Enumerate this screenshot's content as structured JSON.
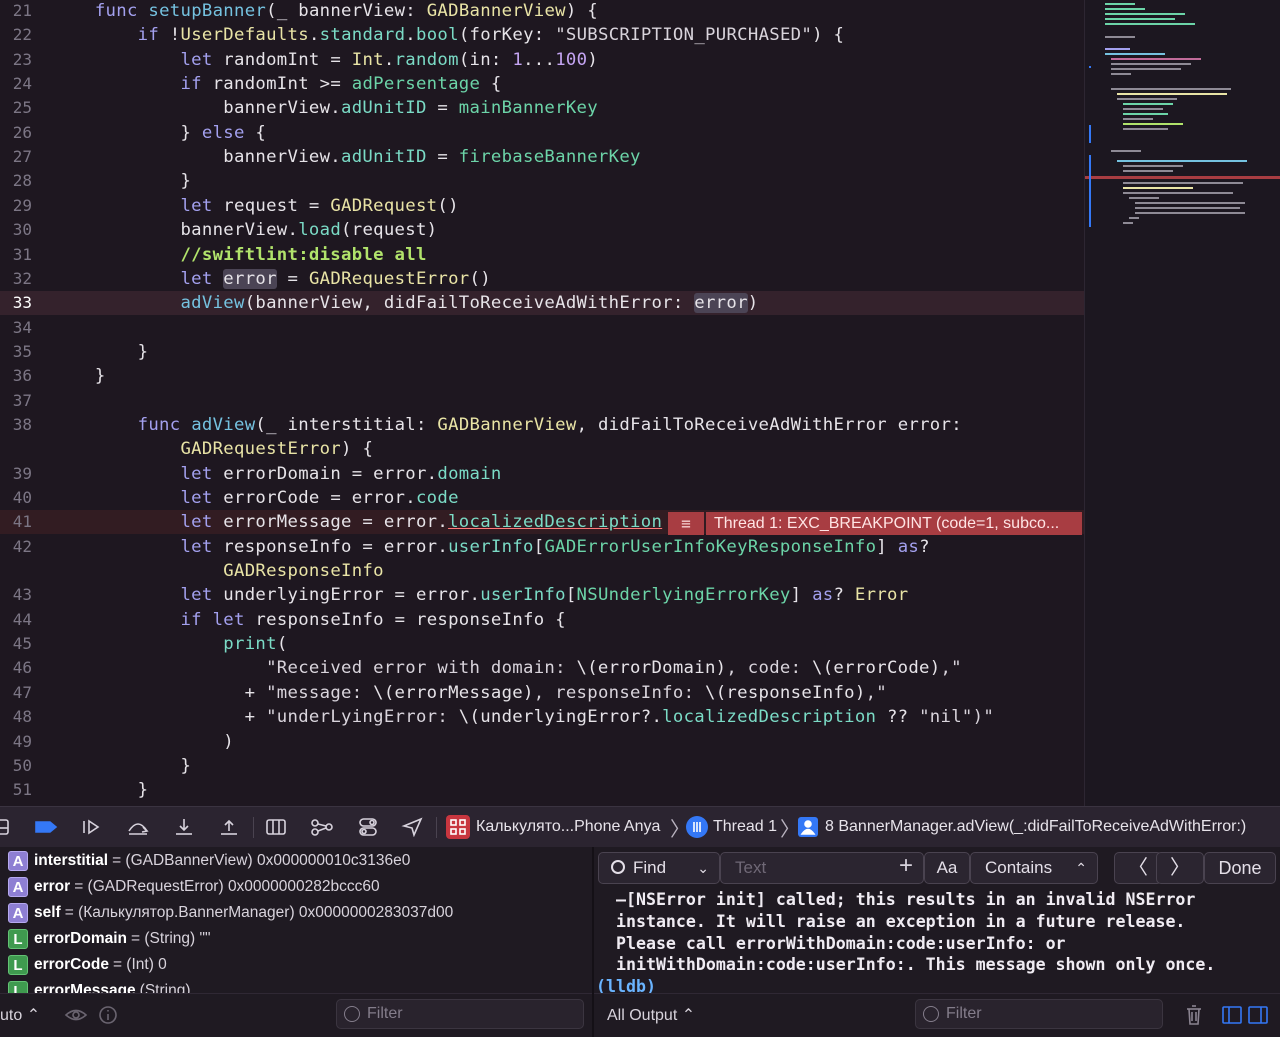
{
  "editor": {
    "lines": [
      {
        "n": "21",
        "tokens": [
          [
            "    ",
            ""
          ],
          [
            "func",
            "kw"
          ],
          [
            " ",
            ""
          ],
          [
            "setupBanner",
            "fn"
          ],
          [
            "(_ bannerView: ",
            ""
          ],
          [
            "GADBannerView",
            "ty"
          ],
          [
            ") {",
            ""
          ]
        ]
      },
      {
        "n": "22",
        "tokens": [
          [
            "        ",
            ""
          ],
          [
            "if",
            "kw"
          ],
          [
            " !",
            ""
          ],
          [
            "UserDefaults",
            "ty"
          ],
          [
            ".",
            ""
          ],
          [
            "standard",
            "pr"
          ],
          [
            ".",
            ""
          ],
          [
            "bool",
            "pr"
          ],
          [
            "(forKey: ",
            ""
          ],
          [
            "\"SUBSCRIPTION_PURCHASED\"",
            "st"
          ],
          [
            ") {",
            ""
          ]
        ]
      },
      {
        "n": "23",
        "tokens": [
          [
            "            ",
            ""
          ],
          [
            "let",
            "kw"
          ],
          [
            " randomInt = ",
            ""
          ],
          [
            "Int",
            "ty"
          ],
          [
            ".",
            ""
          ],
          [
            "random",
            "pr"
          ],
          [
            "(in: ",
            ""
          ],
          [
            "1",
            "nm"
          ],
          [
            "...",
            ""
          ],
          [
            "100",
            "nm"
          ],
          [
            ")",
            ""
          ]
        ]
      },
      {
        "n": "24",
        "tokens": [
          [
            "            ",
            ""
          ],
          [
            "if",
            "kw"
          ],
          [
            " randomInt >= ",
            ""
          ],
          [
            "adPersentage",
            "vr"
          ],
          [
            " {",
            ""
          ]
        ]
      },
      {
        "n": "25",
        "tokens": [
          [
            "                bannerView.",
            ""
          ],
          [
            "adUnitID",
            "pr"
          ],
          [
            " = ",
            ""
          ],
          [
            "mainBannerKey",
            "vr"
          ]
        ]
      },
      {
        "n": "26",
        "tokens": [
          [
            "            } ",
            ""
          ],
          [
            "else",
            "kw"
          ],
          [
            " {",
            ""
          ]
        ]
      },
      {
        "n": "27",
        "tokens": [
          [
            "                bannerView.",
            ""
          ],
          [
            "adUnitID",
            "pr"
          ],
          [
            " = ",
            ""
          ],
          [
            "firebaseBannerKey",
            "vr"
          ]
        ]
      },
      {
        "n": "28",
        "tokens": [
          [
            "            }",
            ""
          ]
        ]
      },
      {
        "n": "29",
        "tokens": [
          [
            "            ",
            ""
          ],
          [
            "let",
            "kw"
          ],
          [
            " request = ",
            ""
          ],
          [
            "GADRequest",
            "ty"
          ],
          [
            "()",
            ""
          ]
        ]
      },
      {
        "n": "30",
        "tokens": [
          [
            "            bannerView.",
            ""
          ],
          [
            "load",
            "pr"
          ],
          [
            "(request)",
            ""
          ]
        ]
      },
      {
        "n": "31",
        "tokens": [
          [
            "            ",
            ""
          ],
          [
            "//swiftlint:disable all",
            "cm"
          ]
        ]
      },
      {
        "n": "32",
        "tokens": [
          [
            "            ",
            ""
          ],
          [
            "let",
            "kw"
          ],
          [
            " ",
            ""
          ],
          [
            "error",
            "sel"
          ],
          [
            " = ",
            ""
          ],
          [
            "GADRequestError",
            "ty"
          ],
          [
            "()",
            ""
          ]
        ]
      },
      {
        "n": "33",
        "tokens": [
          [
            "            ",
            ""
          ],
          [
            "adView",
            "fn"
          ],
          [
            "(bannerView, didFailToReceiveAdWithError: ",
            ""
          ],
          [
            "error",
            "sel"
          ],
          [
            ")",
            ""
          ]
        ],
        "hl": "current"
      },
      {
        "n": "34",
        "tokens": []
      },
      {
        "n": "35",
        "tokens": [
          [
            "        }",
            ""
          ]
        ]
      },
      {
        "n": "36",
        "tokens": [
          [
            "    }",
            ""
          ]
        ]
      },
      {
        "n": "37",
        "tokens": []
      },
      {
        "n": "38",
        "tokens": [
          [
            "        ",
            ""
          ],
          [
            "func",
            "kw"
          ],
          [
            " ",
            ""
          ],
          [
            "adView",
            "fn"
          ],
          [
            "(_ interstitial: ",
            ""
          ],
          [
            "GADBannerView",
            "ty"
          ],
          [
            ", didFailToReceiveAdWithError error:",
            ""
          ]
        ]
      },
      {
        "n": "",
        "tokens": [
          [
            "            ",
            ""
          ],
          [
            "GADRequestError",
            "ty"
          ],
          [
            ") {",
            ""
          ]
        ]
      },
      {
        "n": "39",
        "tokens": [
          [
            "            ",
            ""
          ],
          [
            "let",
            "kw"
          ],
          [
            " errorDomain = error.",
            ""
          ],
          [
            "domain",
            "pr"
          ]
        ]
      },
      {
        "n": "40",
        "tokens": [
          [
            "            ",
            ""
          ],
          [
            "let",
            "kw"
          ],
          [
            " errorCode = error.",
            ""
          ],
          [
            "code",
            "pr"
          ]
        ]
      },
      {
        "n": "41",
        "tokens": [
          [
            "            ",
            ""
          ],
          [
            "let",
            "kw"
          ],
          [
            " errorMessage = error.",
            ""
          ],
          [
            "localizedDescription",
            "pr und"
          ]
        ],
        "hl": "break"
      },
      {
        "n": "42",
        "tokens": [
          [
            "            ",
            ""
          ],
          [
            "let",
            "kw"
          ],
          [
            " responseInfo = error.",
            ""
          ],
          [
            "userInfo",
            "pr"
          ],
          [
            "[",
            ""
          ],
          [
            "GADErrorUserInfoKeyResponseInfo",
            "vr"
          ],
          [
            "] ",
            ""
          ],
          [
            "as",
            "kw"
          ],
          [
            "?",
            ""
          ]
        ]
      },
      {
        "n": "",
        "tokens": [
          [
            "                ",
            ""
          ],
          [
            "GADResponseInfo",
            "ty"
          ]
        ]
      },
      {
        "n": "43",
        "tokens": [
          [
            "            ",
            ""
          ],
          [
            "let",
            "kw"
          ],
          [
            " underlyingError = error.",
            ""
          ],
          [
            "userInfo",
            "pr"
          ],
          [
            "[",
            ""
          ],
          [
            "NSUnderlyingErrorKey",
            "vr"
          ],
          [
            "] ",
            ""
          ],
          [
            "as",
            "kw"
          ],
          [
            "? ",
            ""
          ],
          [
            "Error",
            "ty"
          ]
        ]
      },
      {
        "n": "44",
        "tokens": [
          [
            "            ",
            ""
          ],
          [
            "if",
            "kw"
          ],
          [
            " ",
            ""
          ],
          [
            "let",
            "kw"
          ],
          [
            " responseInfo = responseInfo {",
            ""
          ]
        ]
      },
      {
        "n": "45",
        "tokens": [
          [
            "                ",
            ""
          ],
          [
            "print",
            "pr"
          ],
          [
            "(",
            ""
          ]
        ]
      },
      {
        "n": "46",
        "tokens": [
          [
            "                    ",
            ""
          ],
          [
            "\"Received error with domain: ",
            "st"
          ],
          [
            "\\(errorDomain)",
            ""
          ],
          [
            ", code: ",
            "st"
          ],
          [
            "\\(errorCode)",
            ""
          ],
          [
            ",\"",
            "st"
          ]
        ]
      },
      {
        "n": "47",
        "tokens": [
          [
            "                  + ",
            ""
          ],
          [
            "\"message: ",
            "st"
          ],
          [
            "\\(errorMessage)",
            ""
          ],
          [
            ", responseInfo: ",
            "st"
          ],
          [
            "\\(responseInfo)",
            ""
          ],
          [
            ",\"",
            "st"
          ]
        ]
      },
      {
        "n": "48",
        "tokens": [
          [
            "                  + ",
            ""
          ],
          [
            "\"underLyingError: ",
            "st"
          ],
          [
            "\\(underlyingError?.",
            ""
          ],
          [
            "localizedDescription",
            "pr"
          ],
          [
            " ?? ",
            ""
          ],
          [
            "\"nil\"",
            "st"
          ],
          [
            ")\"",
            "st"
          ]
        ]
      },
      {
        "n": "49",
        "tokens": [
          [
            "                )",
            ""
          ]
        ]
      },
      {
        "n": "50",
        "tokens": [
          [
            "            }",
            ""
          ]
        ]
      },
      {
        "n": "51",
        "tokens": [
          [
            "        }",
            ""
          ]
        ]
      }
    ],
    "breakpoint_message": "Thread 1: EXC_BREAKPOINT (code=1, subco...",
    "breakpoint_icon": "list-lines-icon"
  },
  "debugbar": {
    "scheme": "Калькулято...Phone Anya",
    "thread": "Thread 1",
    "frame": "8 BannerManager.adView(_:didFailToReceiveAdWithError:)"
  },
  "variables": [
    {
      "kind": "A",
      "name": "interstitial",
      "value": "= (GADBannerView) 0x000000010c3136e0"
    },
    {
      "kind": "A",
      "name": "error",
      "value": "= (GADRequestError) 0x0000000282bccc60"
    },
    {
      "kind": "A",
      "name": "self",
      "value": "= (Калькулятор.BannerManager) 0x0000000283037d00"
    },
    {
      "kind": "L",
      "name": "errorDomain",
      "value": "= (String) \"\""
    },
    {
      "kind": "L",
      "name": "errorCode",
      "value": "= (Int) 0"
    },
    {
      "kind": "L",
      "name": "errorMessage",
      "value": "(String)"
    }
  ],
  "vars_footer": {
    "scope": "uto ⌃",
    "filter_placeholder": "Filter"
  },
  "find": {
    "mode": "Find",
    "placeholder": "Text",
    "case_label": "Aa",
    "match": "Contains",
    "done": "Done"
  },
  "console": {
    "output": [
      "  –[NSError init] called; this results in an invalid NSError",
      "  instance. It will raise an exception in a future release.",
      "  Please call errorWithDomain:code:userInfo: or",
      "  initWithDomain:code:userInfo:. This message shown only once."
    ],
    "prompt": "(lldb)"
  },
  "console_footer": {
    "output_selector": "All Output ⌃",
    "filter_placeholder": "Filter"
  },
  "colors": {
    "accent": "#3478f6",
    "breakpoint_red": "#a83d42"
  }
}
